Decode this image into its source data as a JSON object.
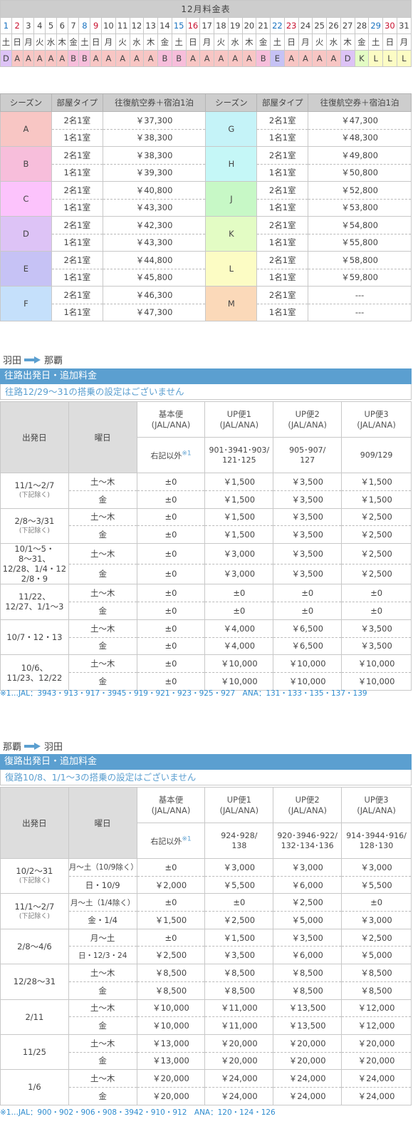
{
  "calendar": {
    "title": "12月料金表",
    "days": [
      "1",
      "2",
      "3",
      "4",
      "5",
      "6",
      "7",
      "8",
      "9",
      "10",
      "11",
      "12",
      "13",
      "14",
      "15",
      "16",
      "17",
      "18",
      "19",
      "20",
      "21",
      "22",
      "23",
      "24",
      "25",
      "26",
      "27",
      "28",
      "29",
      "30",
      "31"
    ],
    "weekdays": [
      "土",
      "日",
      "月",
      "火",
      "水",
      "木",
      "金",
      "土",
      "日",
      "月",
      "火",
      "水",
      "木",
      "金",
      "土",
      "日",
      "月",
      "火",
      "水",
      "木",
      "金",
      "土",
      "日",
      "月",
      "火",
      "水",
      "木",
      "金",
      "土",
      "日",
      "月"
    ],
    "seasons": [
      "D",
      "A",
      "A",
      "A",
      "A",
      "A",
      "B",
      "B",
      "A",
      "A",
      "A",
      "A",
      "A",
      "B",
      "B",
      "A",
      "A",
      "A",
      "A",
      "A",
      "B",
      "E",
      "A",
      "A",
      "A",
      "A",
      "D",
      "K",
      "L",
      "L",
      "L"
    ]
  },
  "price_table": {
    "headers": [
      "シーズン",
      "部屋タイプ",
      "往復航空券＋宿泊1泊",
      "シーズン",
      "部屋タイプ",
      "往復航空券＋宿泊1泊"
    ],
    "rows": [
      {
        "left": {
          "season": "A",
          "r1": "2名1室",
          "p1": "￥37,300",
          "r2": "1名1室",
          "p2": "￥38,300"
        },
        "right": {
          "season": "G",
          "r1": "2名1室",
          "p1": "￥47,300",
          "r2": "1名1室",
          "p2": "￥48,300"
        }
      },
      {
        "left": {
          "season": "B",
          "r1": "2名1室",
          "p1": "￥38,300",
          "r2": "1名1室",
          "p2": "￥39,300"
        },
        "right": {
          "season": "H",
          "r1": "2名1室",
          "p1": "￥49,800",
          "r2": "1名1室",
          "p2": "￥50,800"
        }
      },
      {
        "left": {
          "season": "C",
          "r1": "2名1室",
          "p1": "￥40,800",
          "r2": "1名1室",
          "p2": "￥43,300"
        },
        "right": {
          "season": "J",
          "r1": "2名1室",
          "p1": "￥52,800",
          "r2": "1名1室",
          "p2": "￥53,800"
        }
      },
      {
        "left": {
          "season": "D",
          "r1": "2名1室",
          "p1": "￥42,300",
          "r2": "1名1室",
          "p2": "￥43,300"
        },
        "right": {
          "season": "K",
          "r1": "2名1室",
          "p1": "￥54,800",
          "r2": "1名1室",
          "p2": "￥55,800"
        }
      },
      {
        "left": {
          "season": "E",
          "r1": "2名1室",
          "p1": "￥44,800",
          "r2": "1名1室",
          "p2": "￥45,800"
        },
        "right": {
          "season": "L",
          "r1": "2名1室",
          "p1": "￥58,800",
          "r2": "1名1室",
          "p2": "￥59,800"
        }
      },
      {
        "left": {
          "season": "F",
          "r1": "2名1室",
          "p1": "￥46,300",
          "r2": "1名1室",
          "p2": "￥47,300"
        },
        "right": {
          "season": "M",
          "r1": "2名1室",
          "p1": "---",
          "r2": "1名1室",
          "p2": "---"
        }
      }
    ]
  },
  "outbound": {
    "route_from": "羽田",
    "route_to": "那覇",
    "bar": "往路出発日・追加料金",
    "note": "往路12/29～31の搭乗の設定はございません",
    "h_date": "出発日",
    "h_dow": "曜日",
    "h_basic": "基本便\n(JAL/ANA)",
    "h_up1": "UP便1\n(JAL/ANA)",
    "h_up2": "UP便2\n(JAL/ANA)",
    "h_up3": "UP便3\n(JAL/ANA)",
    "c_basic": "右記以外",
    "c_basic_mark": "※1",
    "c_up1": "901･3941･903/\n121･125",
    "c_up2": "905･907/\n127",
    "c_up3": "909/129",
    "groups": [
      {
        "date": "11/1～2/7",
        "sub": "(下記除く)",
        "rows": [
          [
            "土～木",
            "±0",
            "￥1,500",
            "￥3,500",
            "￥1,500"
          ],
          [
            "金",
            "±0",
            "￥1,500",
            "￥3,500",
            "￥1,500"
          ]
        ]
      },
      {
        "date": "2/8～3/31",
        "sub": "(下記除く)",
        "rows": [
          [
            "土～木",
            "±0",
            "￥1,500",
            "￥3,500",
            "￥2,500"
          ],
          [
            "金",
            "±0",
            "￥1,500",
            "￥3,500",
            "￥2,500"
          ]
        ]
      },
      {
        "date": "10/1～5・\n8～31、\n12/28、1/4・12\n2/8・9",
        "sub": "",
        "rows": [
          [
            "土～木",
            "±0",
            "￥3,000",
            "￥3,500",
            "￥2,500"
          ],
          [
            "金",
            "±0",
            "￥3,000",
            "￥3,500",
            "￥2,500"
          ]
        ]
      },
      {
        "date": "11/22、\n12/27、1/1～3",
        "sub": "",
        "rows": [
          [
            "土～木",
            "±0",
            "±0",
            "±0",
            "±0"
          ],
          [
            "金",
            "±0",
            "±0",
            "±0",
            "±0"
          ]
        ]
      },
      {
        "date": "10/7・12・13",
        "sub": "",
        "rows": [
          [
            "土～木",
            "±0",
            "￥4,000",
            "￥6,500",
            "￥3,500"
          ],
          [
            "金",
            "±0",
            "￥4,000",
            "￥6,500",
            "￥3,500"
          ]
        ]
      },
      {
        "date": "10/6、\n11/23、12/22",
        "sub": "",
        "rows": [
          [
            "土～木",
            "±0",
            "￥10,000",
            "￥10,000",
            "￥10,000"
          ],
          [
            "金",
            "±0",
            "￥10,000",
            "￥10,000",
            "￥10,000"
          ]
        ]
      }
    ],
    "footnote": "※1…JAL：3943・913・917・3945・919・921・923・925・927　ANA：131・133・135・137・139"
  },
  "inbound": {
    "route_from": "那覇",
    "route_to": "羽田",
    "bar": "復路出発日・追加料金",
    "note": "復路10/8、1/1～3の搭乗の設定はございません",
    "h_date": "出発日",
    "h_dow": "曜日",
    "h_basic": "基本便\n(JAL/ANA)",
    "h_up1": "UP便1\n(JAL/ANA)",
    "h_up2": "UP便2\n(JAL/ANA)",
    "h_up3": "UP便3\n(JAL/ANA)",
    "c_basic": "右記以外",
    "c_basic_mark": "※1",
    "c_up1": "924･928/\n138",
    "c_up2": "920･3946･922/\n132･134･136",
    "c_up3": "914･3944･916/\n128･130",
    "groups": [
      {
        "date": "10/2～31",
        "sub": "(下記除く)",
        "rows": [
          [
            "月～土（10/9除く）",
            "±0",
            "￥3,000",
            "￥3,000",
            "￥3,000"
          ],
          [
            "日・10/9",
            "￥2,000",
            "￥5,500",
            "￥6,000",
            "￥5,500"
          ]
        ]
      },
      {
        "date": "11/1～2/7",
        "sub": "(下記除く)",
        "rows": [
          [
            "月～土（1/4除く）",
            "±0",
            "±0",
            "￥2,500",
            "±0"
          ],
          [
            "金・1/4",
            "￥1,500",
            "￥2,500",
            "￥5,000",
            "￥3,000"
          ]
        ]
      },
      {
        "date": "2/8～4/6",
        "sub": "",
        "rows": [
          [
            "月～土",
            "±0",
            "￥1,500",
            "￥3,500",
            "￥2,500"
          ],
          [
            "日・12/3・24",
            "￥2,500",
            "￥3,500",
            "￥6,000",
            "￥5,000"
          ]
        ]
      },
      {
        "date": "12/28～31",
        "sub": "",
        "rows": [
          [
            "土～木",
            "￥8,500",
            "￥8,500",
            "￥8,500",
            "￥8,500"
          ],
          [
            "金",
            "￥8,500",
            "￥8,500",
            "￥8,500",
            "￥8,500"
          ]
        ]
      },
      {
        "date": "2/11",
        "sub": "",
        "rows": [
          [
            "土～木",
            "￥10,000",
            "￥11,000",
            "￥13,500",
            "￥12,000"
          ],
          [
            "金",
            "￥10,000",
            "￥11,000",
            "￥13,500",
            "￥12,000"
          ]
        ]
      },
      {
        "date": "11/25",
        "sub": "",
        "rows": [
          [
            "土～木",
            "￥13,000",
            "￥20,000",
            "￥20,000",
            "￥20,000"
          ],
          [
            "金",
            "￥13,000",
            "￥20,000",
            "￥20,000",
            "￥20,000"
          ]
        ]
      },
      {
        "date": "1/6",
        "sub": "",
        "rows": [
          [
            "土～木",
            "￥20,000",
            "￥24,000",
            "￥24,000",
            "￥24,000"
          ],
          [
            "金",
            "￥20,000",
            "￥24,000",
            "￥24,000",
            "￥24,000"
          ]
        ]
      }
    ],
    "footnote": "※1…JAL：900・902・906・908・3942・910・912　ANA：120・124・126"
  },
  "colors": {
    "accent": "#5b9fd0",
    "saturday": "#1a73c0",
    "sunday": "#c8102e",
    "A": "#f8c6c4",
    "B": "#f7bedb",
    "C": "#fcc3fc",
    "D": "#ddc3f6",
    "E": "#c6c2f5",
    "F": "#c5e0fb",
    "G": "#c5f3f8",
    "H": "#c5f7f7",
    "J": "#c7f8c6",
    "K": "#e3fcc4",
    "L": "#fcfcc4",
    "M": "#fbd9b9"
  }
}
